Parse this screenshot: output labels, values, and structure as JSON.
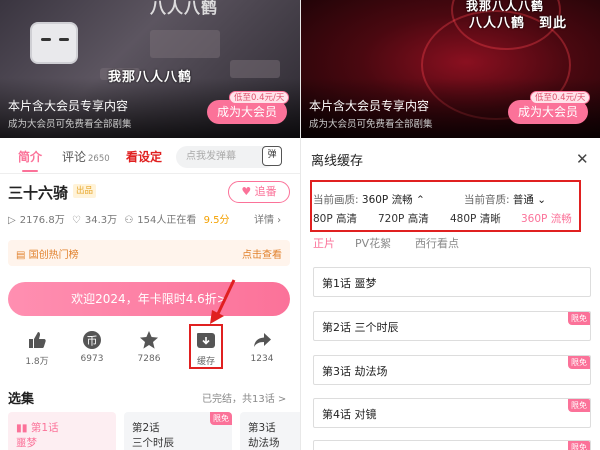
{
  "left": {
    "video": {
      "subtitle_top": "八人八鹤",
      "subtitle_mid": "我那八人八鹤",
      "vip_title": "本片含大会员专享内容",
      "vip_sub": "成为大会员可免费看全部剧集",
      "vip_button": "成为大会员",
      "vip_tag": "低至0.4元/天"
    },
    "tabs": {
      "intro": "简介",
      "comments": "评论",
      "comments_count": "2650",
      "setting": "看设定",
      "danmu_placeholder": "点我发弹幕",
      "danmu_icon_text": "弹"
    },
    "show": {
      "title": "三十六骑",
      "badge": "出品",
      "follow": "追番",
      "plays": "2176.8万",
      "likes": "34.3万",
      "watching": "154人正在看",
      "score": "9.5分",
      "details": "详情"
    },
    "rank": {
      "left": "国创热门榜",
      "right": "点击查看"
    },
    "promo": "欢迎2024，年卡限时4.6折>",
    "actions": [
      {
        "label": "1.8万",
        "icon": "thumbs-up-icon"
      },
      {
        "label": "6973",
        "icon": "coin-icon"
      },
      {
        "label": "7286",
        "icon": "star-icon"
      },
      {
        "label": "缓存",
        "icon": "download-icon"
      },
      {
        "label": "1234",
        "icon": "share-icon"
      }
    ],
    "episodes_header": {
      "title": "选集",
      "meta": "已完结，共13话 >"
    },
    "episode_cards": [
      {
        "line1": "第1话",
        "line2": "噩梦",
        "free": ""
      },
      {
        "line1": "第2话",
        "line2": "三个时辰",
        "free": "限免"
      },
      {
        "line1": "第3话",
        "line2": "劫法场",
        "free": ""
      }
    ]
  },
  "right": {
    "video": {
      "subtitle_top": "我那八人八鹤",
      "subtitle_mid": "八人八鹤　到此",
      "vip_title": "本片含大会员专享内容",
      "vip_sub": "成为大会员可免费看全部剧集",
      "vip_button": "成为大会员",
      "vip_tag": "低至0.4元/天"
    },
    "cache_title": "离线缓存",
    "close_icon": "✕",
    "quality": {
      "video_label": "当前画质:",
      "video_value": "360P 流畅",
      "audio_label": "当前音质:",
      "audio_value": "普通",
      "options": [
        "80P 高清",
        "720P 高清",
        "480P 清晰",
        "360P 流畅"
      ]
    },
    "sub_tabs": [
      "正片",
      "PV花絮",
      "西行看点"
    ],
    "episodes": [
      {
        "title": "第1话 噩梦",
        "free": ""
      },
      {
        "title": "第2话 三个时辰",
        "free": "限免"
      },
      {
        "title": "第3话 劫法场",
        "free": "限免"
      },
      {
        "title": "第4话 对镜",
        "free": "限免"
      },
      {
        "title": "",
        "free": "限免"
      }
    ]
  }
}
